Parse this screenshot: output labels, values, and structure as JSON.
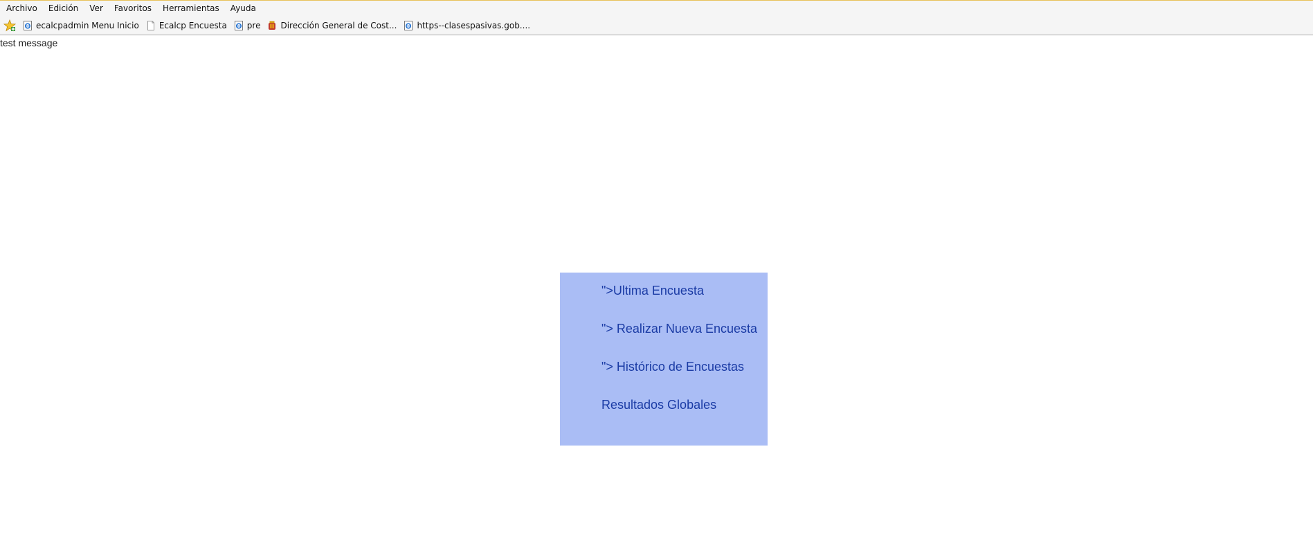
{
  "menubar": {
    "items": [
      "Archivo",
      "Edición",
      "Ver",
      "Favoritos",
      "Herramientas",
      "Ayuda"
    ]
  },
  "favorites": {
    "star_icon": "favorites-star-icon",
    "items": [
      {
        "label": "ecalcpadmin Menu Inicio",
        "icon": "ie-page-icon"
      },
      {
        "label": "Ecalcp Encuesta",
        "icon": "blank-page-icon"
      },
      {
        "label": "pre",
        "icon": "ie-page-icon"
      },
      {
        "label": "Dirección General de Cost...",
        "icon": "government-seal-icon"
      },
      {
        "label": "https--clasespasivas.gob....",
        "icon": "ie-page-icon"
      }
    ]
  },
  "page": {
    "message": "test message"
  },
  "survey_menu": {
    "background": "#aabdf5",
    "link_color": "#1a3ba5",
    "links": [
      "\">Ultima Encuesta",
      "\"> Realizar Nueva Encuesta",
      "\"> Histórico de Encuestas",
      "Resultados Globales"
    ]
  }
}
